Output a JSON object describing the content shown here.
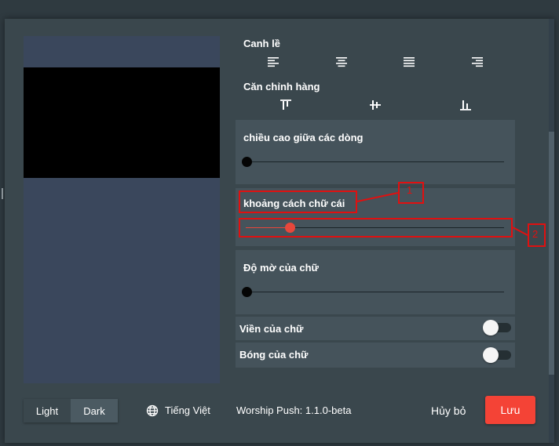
{
  "settings": {
    "align_label": "Canh lề",
    "align_icons": [
      "align-left-icon",
      "align-center-icon",
      "align-justify-icon",
      "align-right-icon"
    ],
    "vertical_label": "Căn chỉnh hàng",
    "vertical_icons": [
      "align-top-icon",
      "align-middle-icon",
      "align-bottom-icon"
    ],
    "line_height": {
      "label": "chiều cao giữa các dòng",
      "value": 0
    },
    "letter_spacing": {
      "label": "khoảng cách chữ cái",
      "value": 0.17
    },
    "opacity": {
      "label": "Độ mờ của chữ",
      "value": 0
    },
    "outline": {
      "label": "Viền của chữ",
      "on": false
    },
    "shadow": {
      "label": "Bóng của chữ",
      "on": false
    }
  },
  "annotations": {
    "label_1": "1",
    "label_2": "2"
  },
  "footer": {
    "light_label": "Light",
    "dark_label": "Dark",
    "language_label": "Tiếng Việt",
    "version_text": "Worship Push: 1.1.0-beta",
    "cancel_label": "Hủy bỏ",
    "save_label": "Lưu"
  },
  "colors": {
    "accent": "#f44336",
    "slider_active": "#e8473b",
    "annotation": "#e01010"
  }
}
